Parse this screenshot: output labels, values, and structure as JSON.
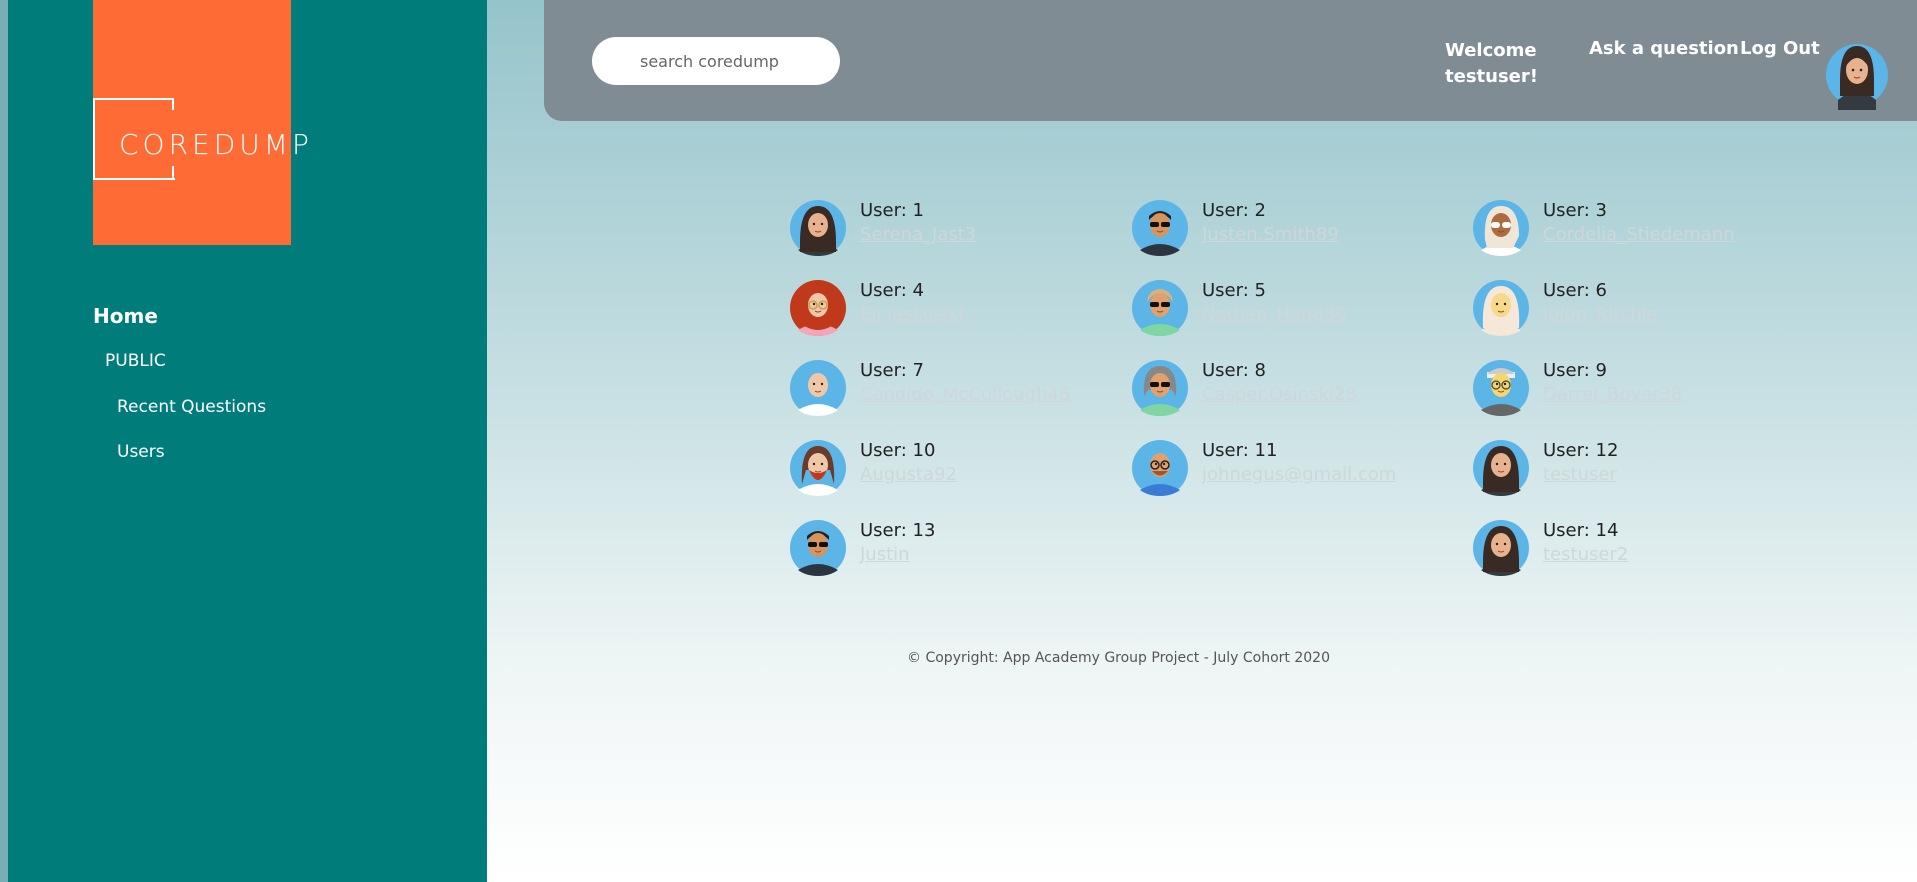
{
  "brand": {
    "name": "COREDUMP",
    "logo_color": "#ff6b35",
    "sidebar_color": "#007d7a"
  },
  "sidebar": {
    "home": "Home",
    "section": "PUBLIC",
    "items": [
      {
        "label": "Recent Questions"
      },
      {
        "label": "Users"
      }
    ]
  },
  "header": {
    "search_placeholder": "search coredump",
    "welcome": "Welcome testuser!",
    "ask": "Ask a question",
    "logout": "Log Out"
  },
  "users": [
    {
      "id": "User: 1",
      "name": "Serena_Jast3",
      "avatar": "woman-dark-hair"
    },
    {
      "id": "User: 2",
      "name": "Justen.Smith89",
      "avatar": "man-sunglasses"
    },
    {
      "id": "User: 3",
      "name": "Cordelia_Stiedemann",
      "avatar": "woman-blonde-sunglasses"
    },
    {
      "id": "User: 4",
      "name": "Eli.Jaskolski",
      "avatar": "woman-red-hair-glasses"
    },
    {
      "id": "User: 5",
      "name": "Nathan_Hand30",
      "avatar": "man-blonde-sunglasses"
    },
    {
      "id": "User: 6",
      "name": "Jolon_Ritchie",
      "avatar": "woman-hijab"
    },
    {
      "id": "User: 7",
      "name": "Candido_McCullough46",
      "avatar": "bald-man"
    },
    {
      "id": "User: 8",
      "name": "Casper.Osinski28",
      "avatar": "gray-hair-sunglasses"
    },
    {
      "id": "User: 9",
      "name": "Darrel_Boyer38",
      "avatar": "man-headband"
    },
    {
      "id": "User: 10",
      "name": "Augusta92",
      "avatar": "man-beard"
    },
    {
      "id": "User: 11",
      "name": "johnegus@gmail.com",
      "avatar": "bald-man-glasses"
    },
    {
      "id": "User: 12",
      "name": "testuser",
      "avatar": "woman-dark-hair"
    },
    {
      "id": "User: 13",
      "name": "Justin",
      "avatar": "man-sunglasses"
    },
    {
      "id": "User: 14",
      "name": "testuser2",
      "avatar": "woman-dark-hair"
    }
  ],
  "footer": "© Copyright: App Academy Group Project - July Cohort 2020"
}
